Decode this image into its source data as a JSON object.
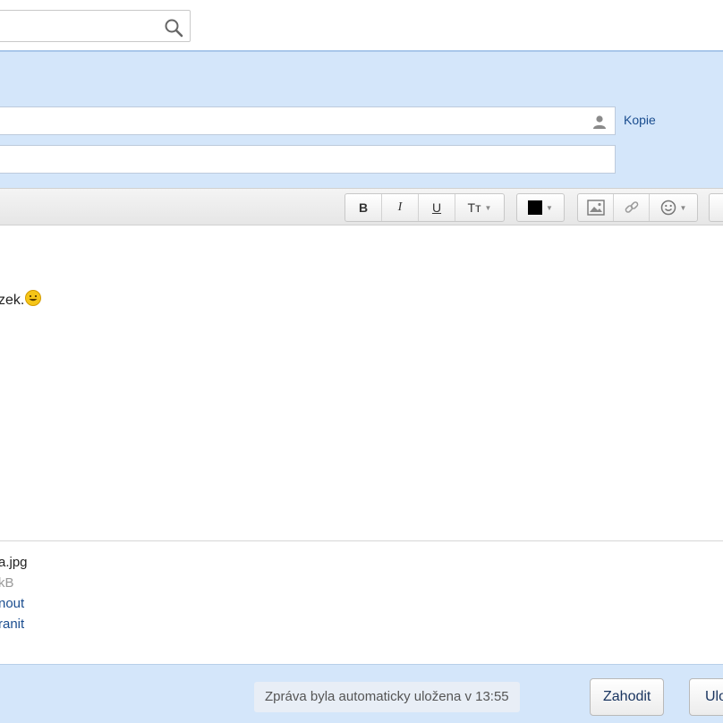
{
  "search": {
    "value": "",
    "placeholder": ""
  },
  "compose": {
    "to_value": "",
    "subject_value": "",
    "cc_link": "Kopie"
  },
  "toolbar": {
    "bold": "B",
    "italic": "I",
    "underline": "U",
    "font_size": "Tт",
    "text_color": "#000000"
  },
  "body": {
    "text": "zek."
  },
  "attachment": {
    "name": "a.jpg",
    "size": "kB",
    "link_remove": "nout",
    "link_save": "ranit"
  },
  "footer": {
    "autosave_status": "Zpráva byla automaticky uložena v 13:55",
    "discard_label": "Zahodit",
    "save_label": "Ulo"
  },
  "colors": {
    "header_bg": "#d4e6fa",
    "link": "#1a4d8f"
  }
}
